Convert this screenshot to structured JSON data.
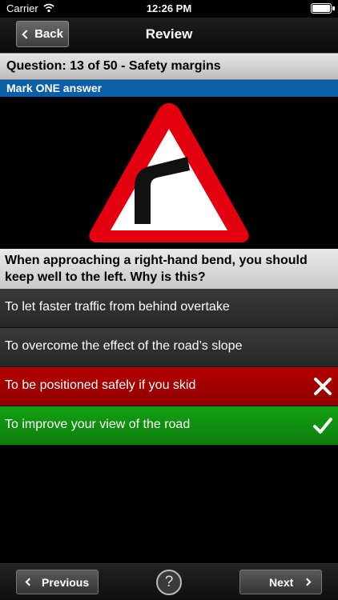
{
  "status_bar": {
    "carrier": "Carrier",
    "time": "12:26 PM"
  },
  "nav": {
    "back_label": "Back",
    "title": "Review"
  },
  "question_header": "Question: 13 of 50 - Safety margins",
  "instruction": "Mark ONE answer",
  "sign": {
    "icon": "bend-to-right-warning-sign",
    "colors": {
      "border": "#e3000f",
      "fill": "#ffffff",
      "symbol": "#000000"
    }
  },
  "question": "When approaching a right-hand bend, you should keep well to the left. Why is this?",
  "answers": [
    {
      "text": "To let faster traffic from behind overtake",
      "state": "neutral"
    },
    {
      "text": "To overcome the effect of the road’s slope",
      "state": "neutral"
    },
    {
      "text": "To be positioned safely if you skid",
      "state": "wrong",
      "icon": "cross-icon"
    },
    {
      "text": "To improve your view of the road",
      "state": "correct",
      "icon": "checkmark-icon"
    }
  ],
  "toolbar": {
    "previous_label": "Previous",
    "next_label": "Next",
    "help_label": "?"
  },
  "colors": {
    "wrong": "#a00000",
    "correct": "#10900f",
    "instruction_bar": "#0b5fa8"
  }
}
